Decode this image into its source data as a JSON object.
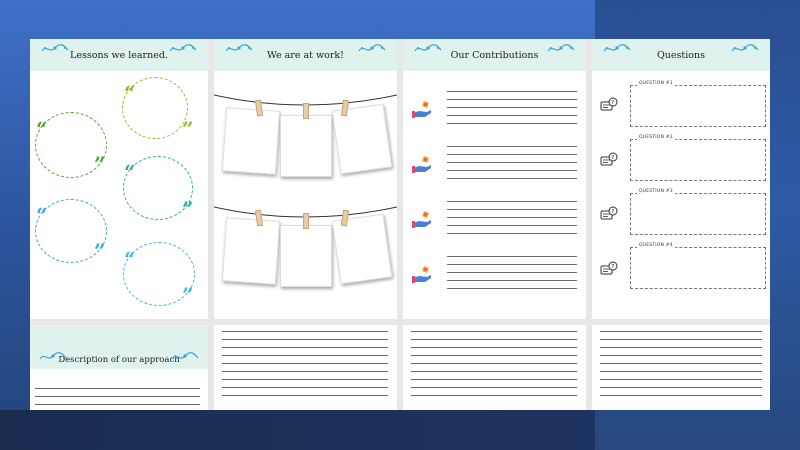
{
  "panels": {
    "lessons": {
      "title": "Lessons we learned."
    },
    "work": {
      "title": "We are at work!"
    },
    "contributions": {
      "title": "Our Contributions"
    },
    "questions": {
      "title": "Questions",
      "items": [
        {
          "label": "QUESTION #1"
        },
        {
          "label": "QUESTION #2"
        },
        {
          "label": "QUESTION #3"
        },
        {
          "label": "QUESTION #4"
        }
      ]
    },
    "approach": {
      "title": "Description of our approach"
    }
  },
  "colors": {
    "header_bg": "#dff2ee",
    "quote_green": "#5aa33a",
    "quote_lime": "#8cbf2e",
    "quote_teal": "#2fae9a",
    "quote_cyan": "#3aa9d6",
    "quote_sky": "#43b7e8",
    "swirl": "#3aa3d1"
  },
  "icons": {
    "quote": "quote-mark-icon",
    "swirl": "ornament-swirl-icon",
    "question": "chat-question-icon",
    "contribution": "hand-giving-icon"
  }
}
